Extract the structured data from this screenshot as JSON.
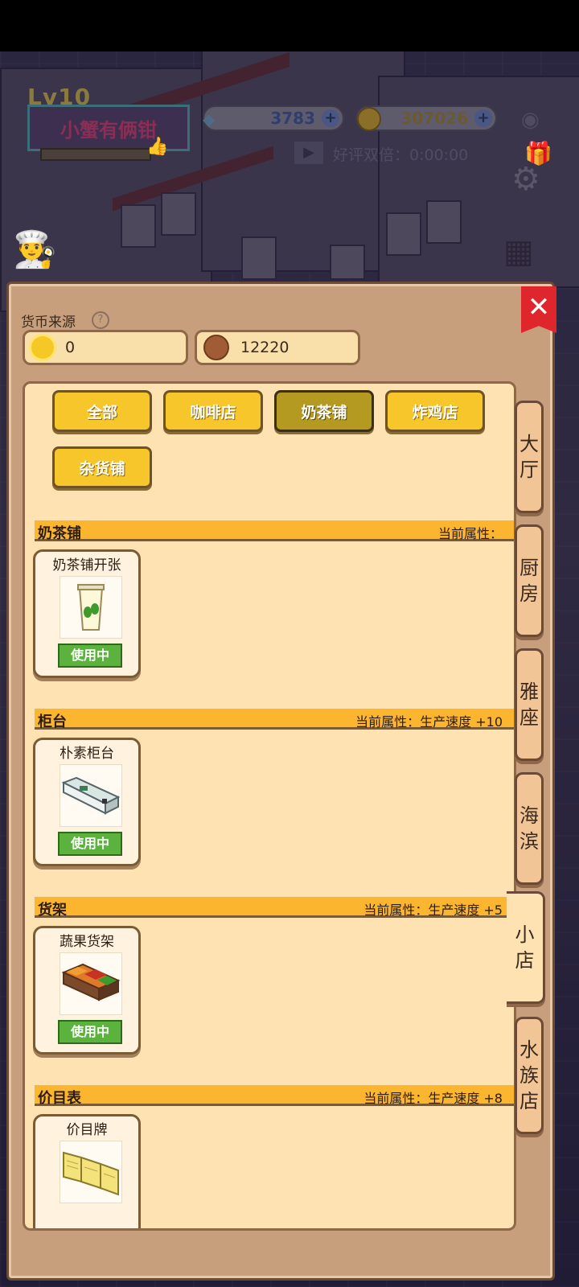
{
  "hud": {
    "level": "Lv10",
    "player_name": "小蟹有俩钳",
    "gems": "3783",
    "coins": "307026",
    "ad_text": "好评双倍：0:00:00"
  },
  "panel": {
    "currency_source_label": "货币来源",
    "help_glyph": "?",
    "close_glyph": "✕",
    "sources": [
      {
        "icon": "sun-icon",
        "value": "0"
      },
      {
        "icon": "copper-coin-icon",
        "value": "12220"
      }
    ],
    "filters": [
      "全部",
      "咖啡店",
      "奶茶铺",
      "炸鸡店",
      "杂货铺"
    ],
    "active_filter": "奶茶铺",
    "sections": [
      {
        "name": "奶茶铺",
        "attr": "当前属性：",
        "item": "奶茶铺开张",
        "status": "使用中",
        "icon": "milk-tea-cup-icon"
      },
      {
        "name": "柜台",
        "attr": "当前属性：生产速度 +10",
        "item": "朴素柜台",
        "status": "使用中",
        "icon": "counter-icon"
      },
      {
        "name": "货架",
        "attr": "当前属性：生产速度 +5",
        "item": "蔬果货架",
        "status": "使用中",
        "icon": "produce-shelf-icon"
      },
      {
        "name": "价目表",
        "attr": "当前属性：生产速度 +8",
        "item": "价目牌",
        "status": "",
        "icon": "price-board-icon"
      }
    ],
    "side_tabs": [
      "大厅",
      "厨房",
      "雅座",
      "海滨",
      "小店",
      "水族店"
    ],
    "active_side_tab": "小店"
  },
  "colors": {
    "panel_bg": "#c79f7d",
    "content_bg": "#fee2b2",
    "filter_yellow": "#f7c62a",
    "filter_active": "#b59a22",
    "section_bar": "#fbb52e",
    "use_green": "#5bb33d",
    "close_red": "#e0262d"
  }
}
